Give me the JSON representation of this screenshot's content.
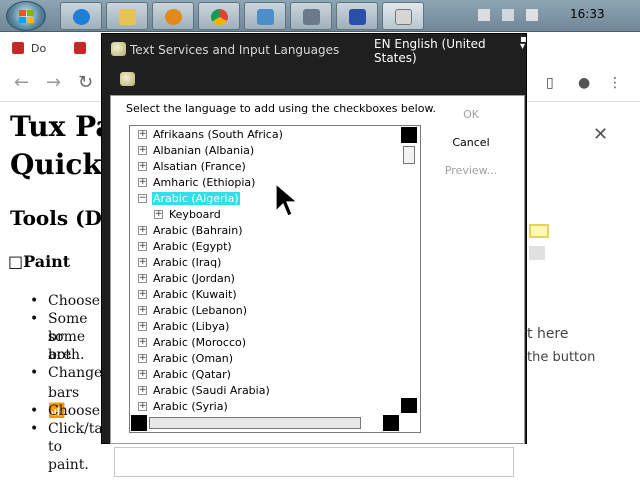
{
  "taskbar": {
    "clock": "16:33",
    "pinned": [
      "start-button",
      "ie-icon",
      "explorer-icon",
      "media-player-icon",
      "chrome-icon",
      "control-panel-icon",
      "paint-icon",
      "tools-icon",
      "keyboard-icon"
    ]
  },
  "browser": {
    "tab_text": "Do",
    "page": {
      "title_line1": "Tux Pa",
      "title_line2": "Quicks",
      "subtitle": "Tools (Dr",
      "section": "□Paint",
      "bullets": [
        "Choose",
        "Some br",
        "some are",
        "both.",
        "Change",
        "bars 📶",
        "Choose",
        "Click/tap",
        "to paint."
      ],
      "right_text1": "t here",
      "right_text2": "the button"
    }
  },
  "dialog": {
    "title": "Text Services and Input Languages",
    "lang_indicator": "EN English (United States)",
    "instruction": "Select the language to add using the checkboxes below.",
    "ok_label": "OK",
    "cancel_label": "Cancel",
    "preview_label": "Preview...",
    "list": [
      {
        "label": "Afrikaans (South Africa)",
        "indent": 0,
        "exp": "+"
      },
      {
        "label": "Albanian (Albania)",
        "indent": 0,
        "exp": "+"
      },
      {
        "label": "Alsatian (France)",
        "indent": 0,
        "exp": "+"
      },
      {
        "label": "Amharic (Ethiopia)",
        "indent": 0,
        "exp": "+"
      },
      {
        "label": "Arabic (Algeria)",
        "indent": 0,
        "exp": "−",
        "selected": true
      },
      {
        "label": "Keyboard",
        "indent": 1,
        "exp": "+"
      },
      {
        "label": "Arabic (Bahrain)",
        "indent": 0,
        "exp": "+"
      },
      {
        "label": "Arabic (Egypt)",
        "indent": 0,
        "exp": "+"
      },
      {
        "label": "Arabic (Iraq)",
        "indent": 0,
        "exp": "+"
      },
      {
        "label": "Arabic (Jordan)",
        "indent": 0,
        "exp": "+"
      },
      {
        "label": "Arabic (Kuwait)",
        "indent": 0,
        "exp": "+"
      },
      {
        "label": "Arabic (Lebanon)",
        "indent": 0,
        "exp": "+"
      },
      {
        "label": "Arabic (Libya)",
        "indent": 0,
        "exp": "+"
      },
      {
        "label": "Arabic (Morocco)",
        "indent": 0,
        "exp": "+"
      },
      {
        "label": "Arabic (Oman)",
        "indent": 0,
        "exp": "+"
      },
      {
        "label": "Arabic (Qatar)",
        "indent": 0,
        "exp": "+"
      },
      {
        "label": "Arabic (Saudi Arabia)",
        "indent": 0,
        "exp": "+"
      },
      {
        "label": "Arabic (Syria)",
        "indent": 0,
        "exp": "+"
      }
    ]
  },
  "colors": {
    "selection": "#2de0ea",
    "dialog_frame": "#1f1f1f",
    "taskbar": "#7f97a5"
  }
}
